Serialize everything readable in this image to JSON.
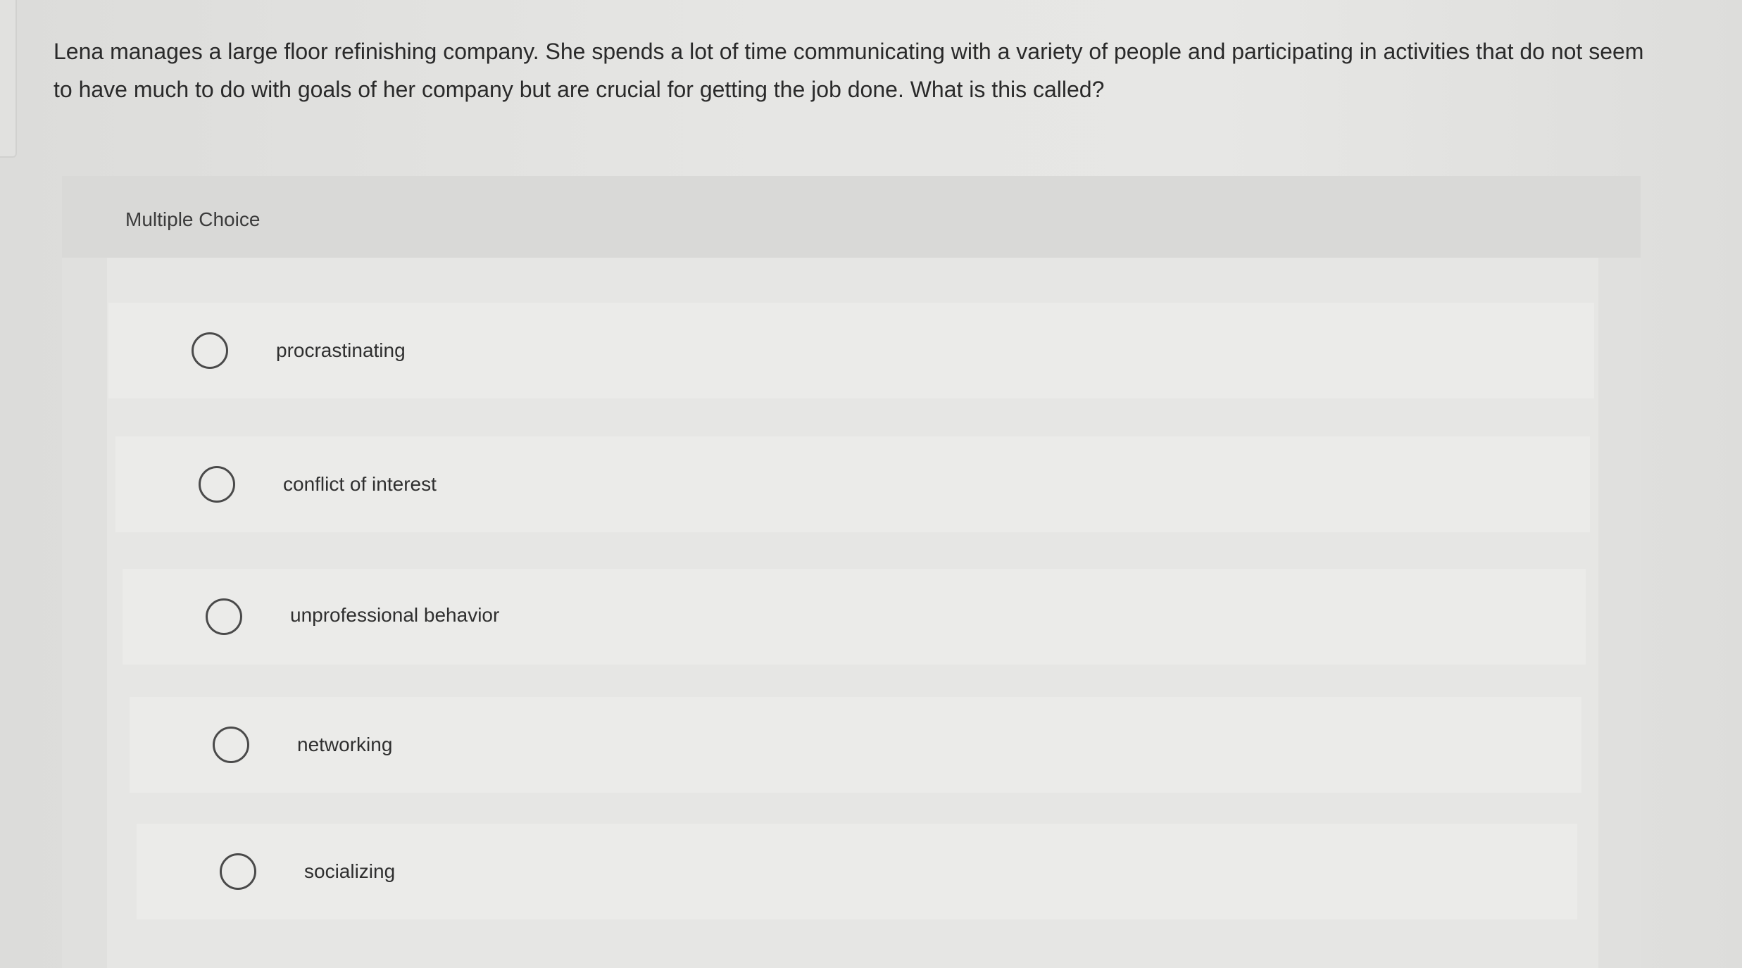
{
  "question": {
    "text": "Lena manages a large floor refinishing company. She spends a lot of time communicating with a variety of people and participating in activities that do not seem to have much to do with goals of her company but are crucial for getting the job done. What is this called?"
  },
  "choice_panel": {
    "label": "Multiple Choice",
    "options": [
      {
        "label": "procrastinating"
      },
      {
        "label": "conflict of interest"
      },
      {
        "label": "unprofessional behavior"
      },
      {
        "label": "networking"
      },
      {
        "label": "socializing"
      }
    ]
  }
}
